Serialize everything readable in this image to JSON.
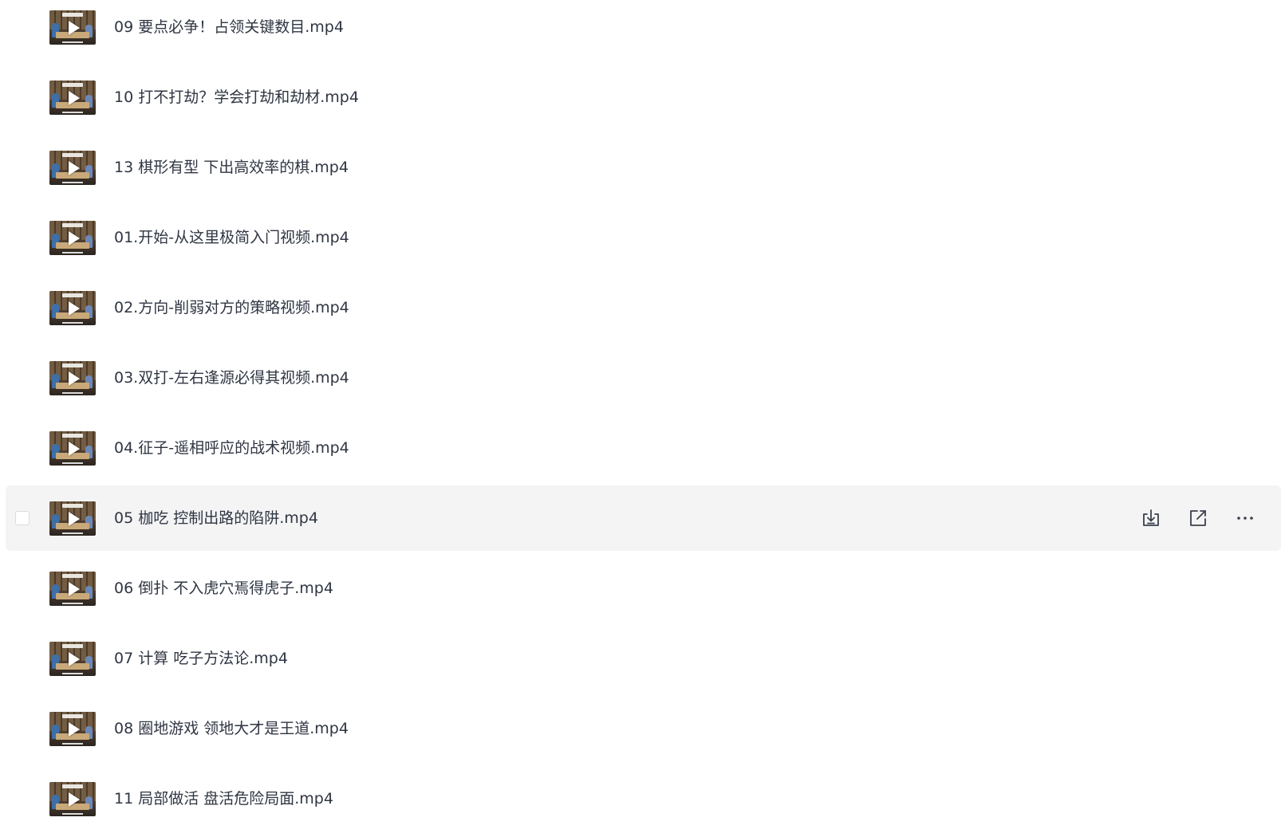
{
  "files": [
    {
      "name": "09 要点必争！占领关键数目.mp4",
      "icon": "video-thumbnail-icon"
    },
    {
      "name": "10 打不打劫？学会打劫和劫材.mp4",
      "icon": "video-thumbnail-icon"
    },
    {
      "name": "13 棋形有型 下出高效率的棋.mp4",
      "icon": "video-thumbnail-icon"
    },
    {
      "name": "01.开始-从这里极简入门视频.mp4",
      "icon": "video-thumbnail-icon"
    },
    {
      "name": "02.方向-削弱对方的策略视频.mp4",
      "icon": "video-thumbnail-icon"
    },
    {
      "name": "03.双打-左右逢源必得其视频.mp4",
      "icon": "video-thumbnail-icon"
    },
    {
      "name": "04.征子-遥相呼应的战术视频.mp4",
      "icon": "video-thumbnail-icon"
    },
    {
      "name": "05 枷吃 控制出路的陷阱.mp4",
      "icon": "video-thumbnail-icon",
      "hovered": true
    },
    {
      "name": "06 倒扑 不入虎穴焉得虎子.mp4",
      "icon": "video-thumbnail-icon"
    },
    {
      "name": "07 计算 吃子方法论.mp4",
      "icon": "video-thumbnail-icon"
    },
    {
      "name": "08 圈地游戏 领地大才是王道.mp4",
      "icon": "video-thumbnail-icon"
    },
    {
      "name": "11 局部做活 盘活危险局面.mp4",
      "icon": "video-thumbnail-icon"
    }
  ],
  "row_actions": {
    "download_icon": "download-icon",
    "share_icon": "share-icon",
    "more_icon": "more-icon"
  },
  "colors": {
    "text": "#2f3542",
    "hover_background": "#f4f4f5",
    "icon": "#3a3f4b"
  }
}
